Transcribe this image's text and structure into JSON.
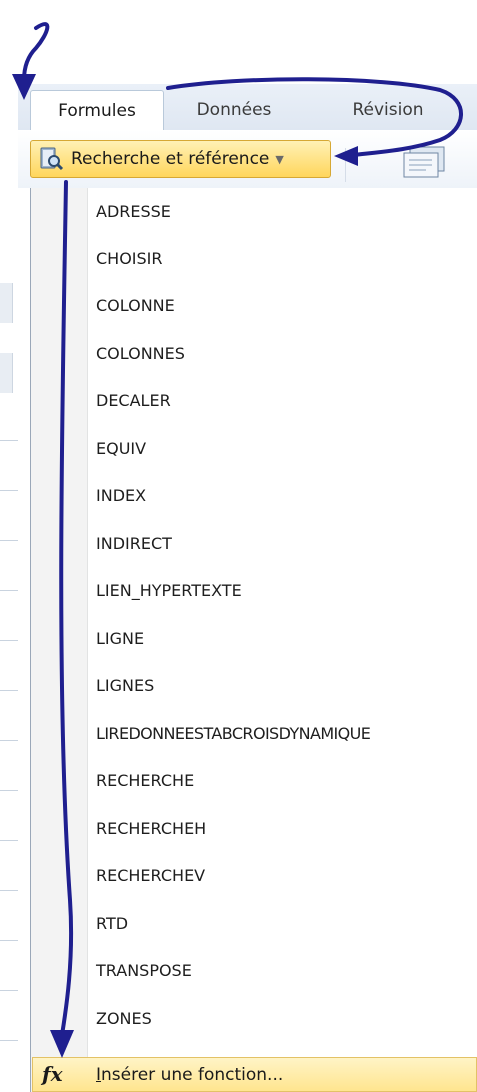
{
  "ribbon": {
    "tabs": [
      {
        "label": "Formules",
        "active": true
      },
      {
        "label": "Données",
        "active": false
      },
      {
        "label": "Révision",
        "active": false
      }
    ],
    "dropdown_button": {
      "label": "Recherche et référence",
      "icon": "book-magnifier-icon"
    },
    "next_group_icon": "function-library-icon"
  },
  "menu": {
    "items": [
      "ADRESSE",
      "CHOISIR",
      "COLONNE",
      "COLONNES",
      "DECALER",
      "EQUIV",
      "INDEX",
      "INDIRECT",
      "LIEN_HYPERTEXTE",
      "LIGNE",
      "LIGNES",
      "LIREDONNEESTABCROISDYNAMIQUE",
      "RECHERCHE",
      "RECHERCHEH",
      "RECHERCHEV",
      "RTD",
      "TRANSPOSE",
      "ZONES"
    ],
    "insert_function": {
      "label_first": "I",
      "label_rest": "nsérer une fonction...",
      "icon": "fx-icon"
    }
  },
  "colors": {
    "arrow": "#1f1f8f",
    "highlight": "#ffd65c",
    "menu_gutter": "#f3f3f3"
  }
}
